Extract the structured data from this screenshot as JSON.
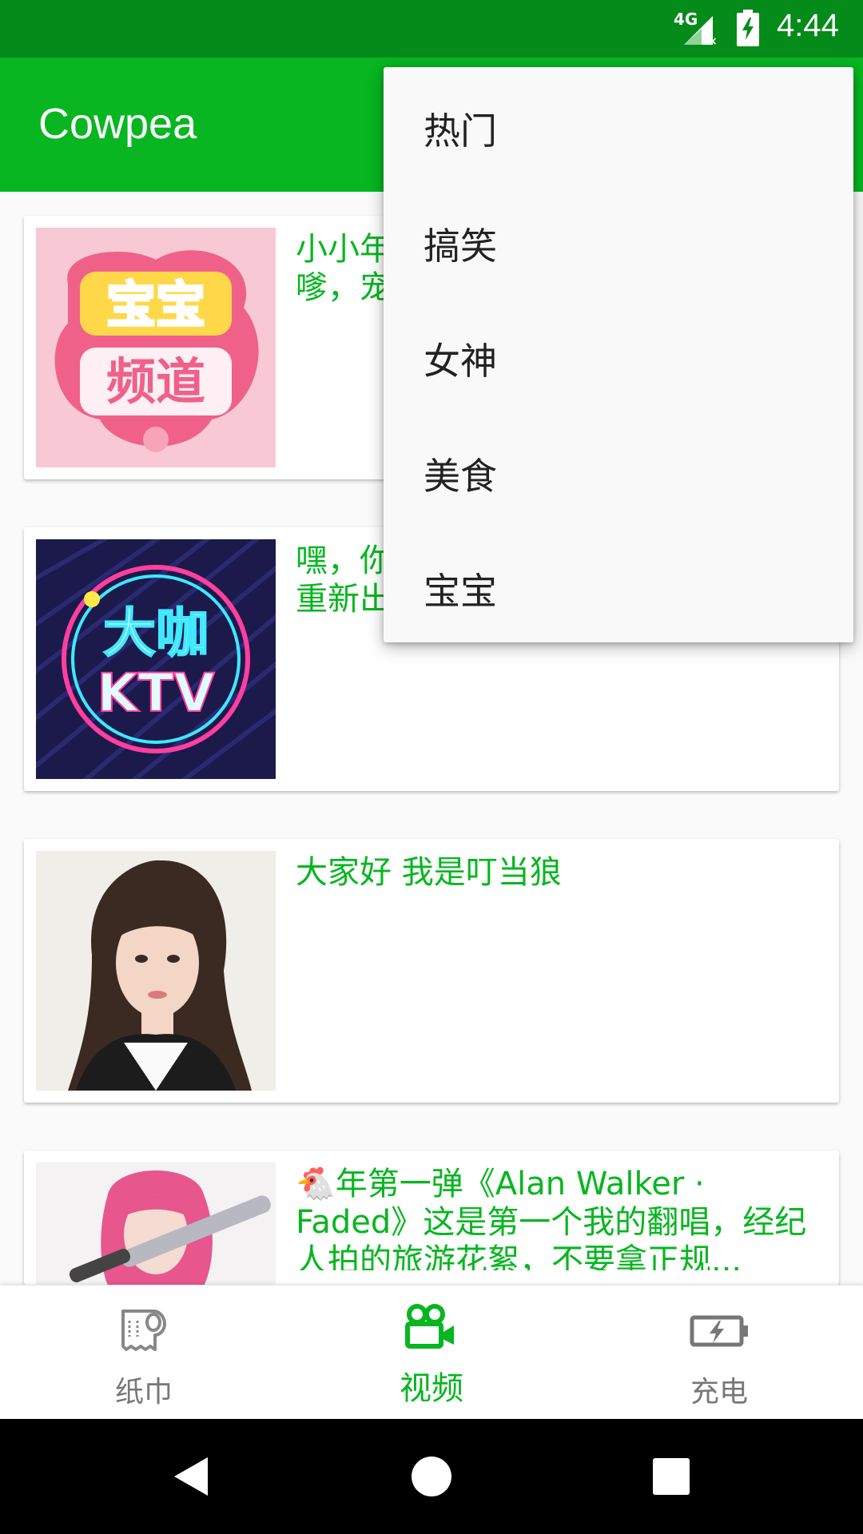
{
  "status_bar": {
    "network": "4G",
    "time": "4:44"
  },
  "app_bar": {
    "title": "Cowpea"
  },
  "feed": [
    {
      "text": "小小年纪就成了\"人生赢家\"叫声嗲嗲，宠溺，真",
      "thumb": "baby-channel-logo"
    },
    {
      "text": "嘿，你好，_Jocie 专辑#你的名字#重新出发。更多...",
      "thumb": "ktv-neon-logo"
    },
    {
      "text": "大家好 我是叮当狼",
      "thumb": "woman-portrait"
    },
    {
      "text": "🐔年第一弹《Alan Walker · Faded》这是第一个我的翻唱，经纪人拍的旅游花絮，不要拿正规...",
      "thumb": "pink-hair-woman-bat"
    }
  ],
  "menu": {
    "items": [
      "热门",
      "搞笑",
      "女神",
      "美食",
      "宝宝"
    ]
  },
  "bottom_nav": {
    "items": [
      {
        "label": "纸巾",
        "icon": "tissue-roll-icon"
      },
      {
        "label": "视频",
        "icon": "video-camera-icon"
      },
      {
        "label": "充电",
        "icon": "battery-charging-icon"
      }
    ],
    "active_index": 1
  },
  "colors": {
    "status_bar": "#058b19",
    "primary": "#07b620",
    "menu_bg": "#f9f9f9",
    "nav_inactive": "#777777"
  }
}
